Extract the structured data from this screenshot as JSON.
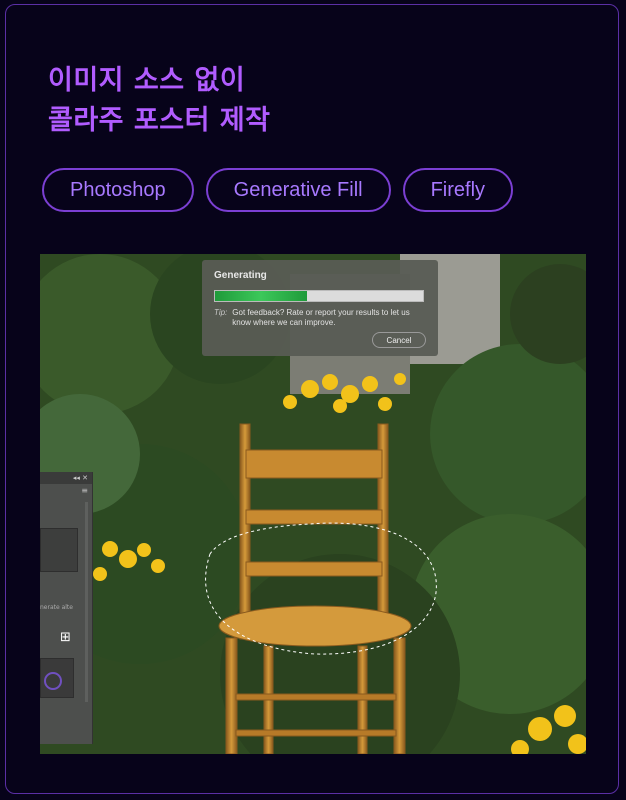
{
  "headline": {
    "line1": "이미지 소스 없이",
    "line2": "콜라주 포스터 제작"
  },
  "tags": [
    "Photoshop",
    "Generative Fill",
    "Firefly"
  ],
  "dialog": {
    "title": "Generating",
    "progress": 0.44,
    "tip_label": "Tip:",
    "tip_text": "Got feedback? Rate or report your results to let us know where we can improve.",
    "cancel_label": "Cancel"
  },
  "panel": {
    "controls": "◂◂  ✕",
    "menu_icon": "≡",
    "grid_icon": "⊞",
    "truncated_text": "nerate alte"
  },
  "colors": {
    "background": "#07031a",
    "accent": "#b15cff",
    "tag_border": "#7b3fd3",
    "progress_fill": "#2fb34a"
  }
}
